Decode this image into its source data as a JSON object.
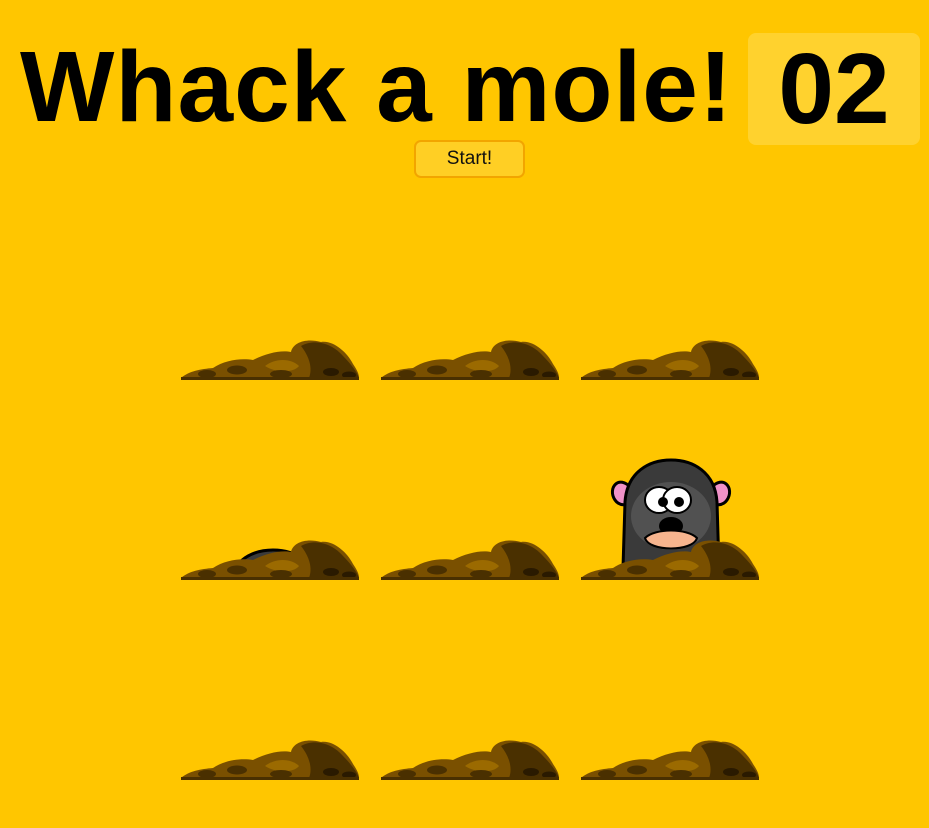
{
  "game": {
    "title": "Whack a mole!",
    "score": "02",
    "start_label": "Start!",
    "colors": {
      "background": "#ffc600",
      "score_box": "#ffd22e",
      "dirt_dark": "#4a3000",
      "dirt_mid": "#7a5000",
      "dirt_light": "#9b6a00",
      "mole_body": "#3a3a3a",
      "mole_nose": "#f6b48e",
      "mole_ears": "#f092c8"
    },
    "holes": [
      {
        "state": "empty"
      },
      {
        "state": "empty"
      },
      {
        "state": "empty"
      },
      {
        "state": "peek"
      },
      {
        "state": "empty"
      },
      {
        "state": "up"
      },
      {
        "state": "empty"
      },
      {
        "state": "empty"
      },
      {
        "state": "empty"
      }
    ]
  }
}
